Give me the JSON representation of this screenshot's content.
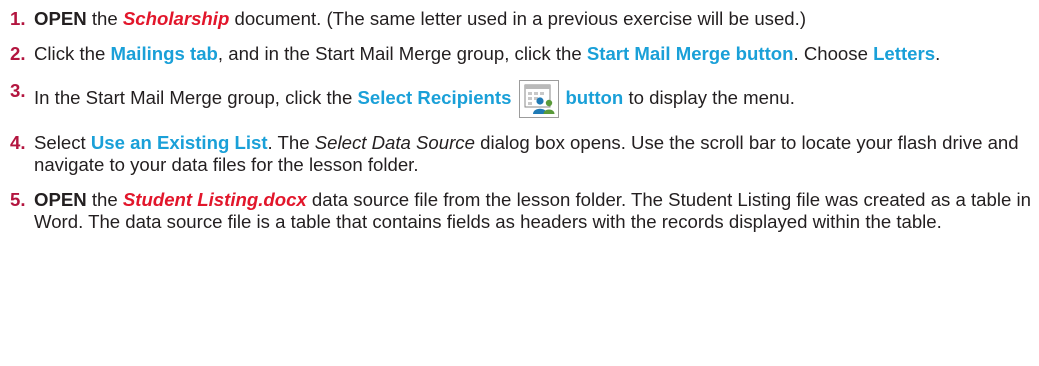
{
  "steps": [
    {
      "num": "1.",
      "parts": [
        "OPEN",
        " the ",
        "Scholarship",
        " document. (The same letter used in a previous exercise will be used.)"
      ]
    },
    {
      "num": "2.",
      "parts": [
        " Click the ",
        "Mailings tab",
        ", and in the Start Mail Merge group, click the ",
        "Start Mail Merge button",
        ". Choose ",
        "Letters",
        "."
      ]
    },
    {
      "num": "3.",
      "parts": [
        " In the Start Mail Merge group, click the ",
        "Select Recipients",
        "button",
        " to display the menu."
      ],
      "icon": "select-recipients-icon"
    },
    {
      "num": "4.",
      "parts": [
        " Select ",
        "Use an Existing List",
        ". The ",
        "Select Data Source",
        " dialog box opens. Use the scroll bar to locate your flash drive and navigate to your data files for the lesson folder."
      ]
    },
    {
      "num": "5.",
      "parts": [
        "OPEN",
        " the ",
        "Student Listing.docx",
        " data source file from the lesson folder. The Student Listing file was created as a table in Word. The data source file is a table that contains fields as headers with the records displayed within the table."
      ]
    }
  ],
  "colors": {
    "number": "#b3153f",
    "document_name": "#e2162b",
    "ui_command": "#1aa0d8",
    "body_text": "#231f20"
  }
}
